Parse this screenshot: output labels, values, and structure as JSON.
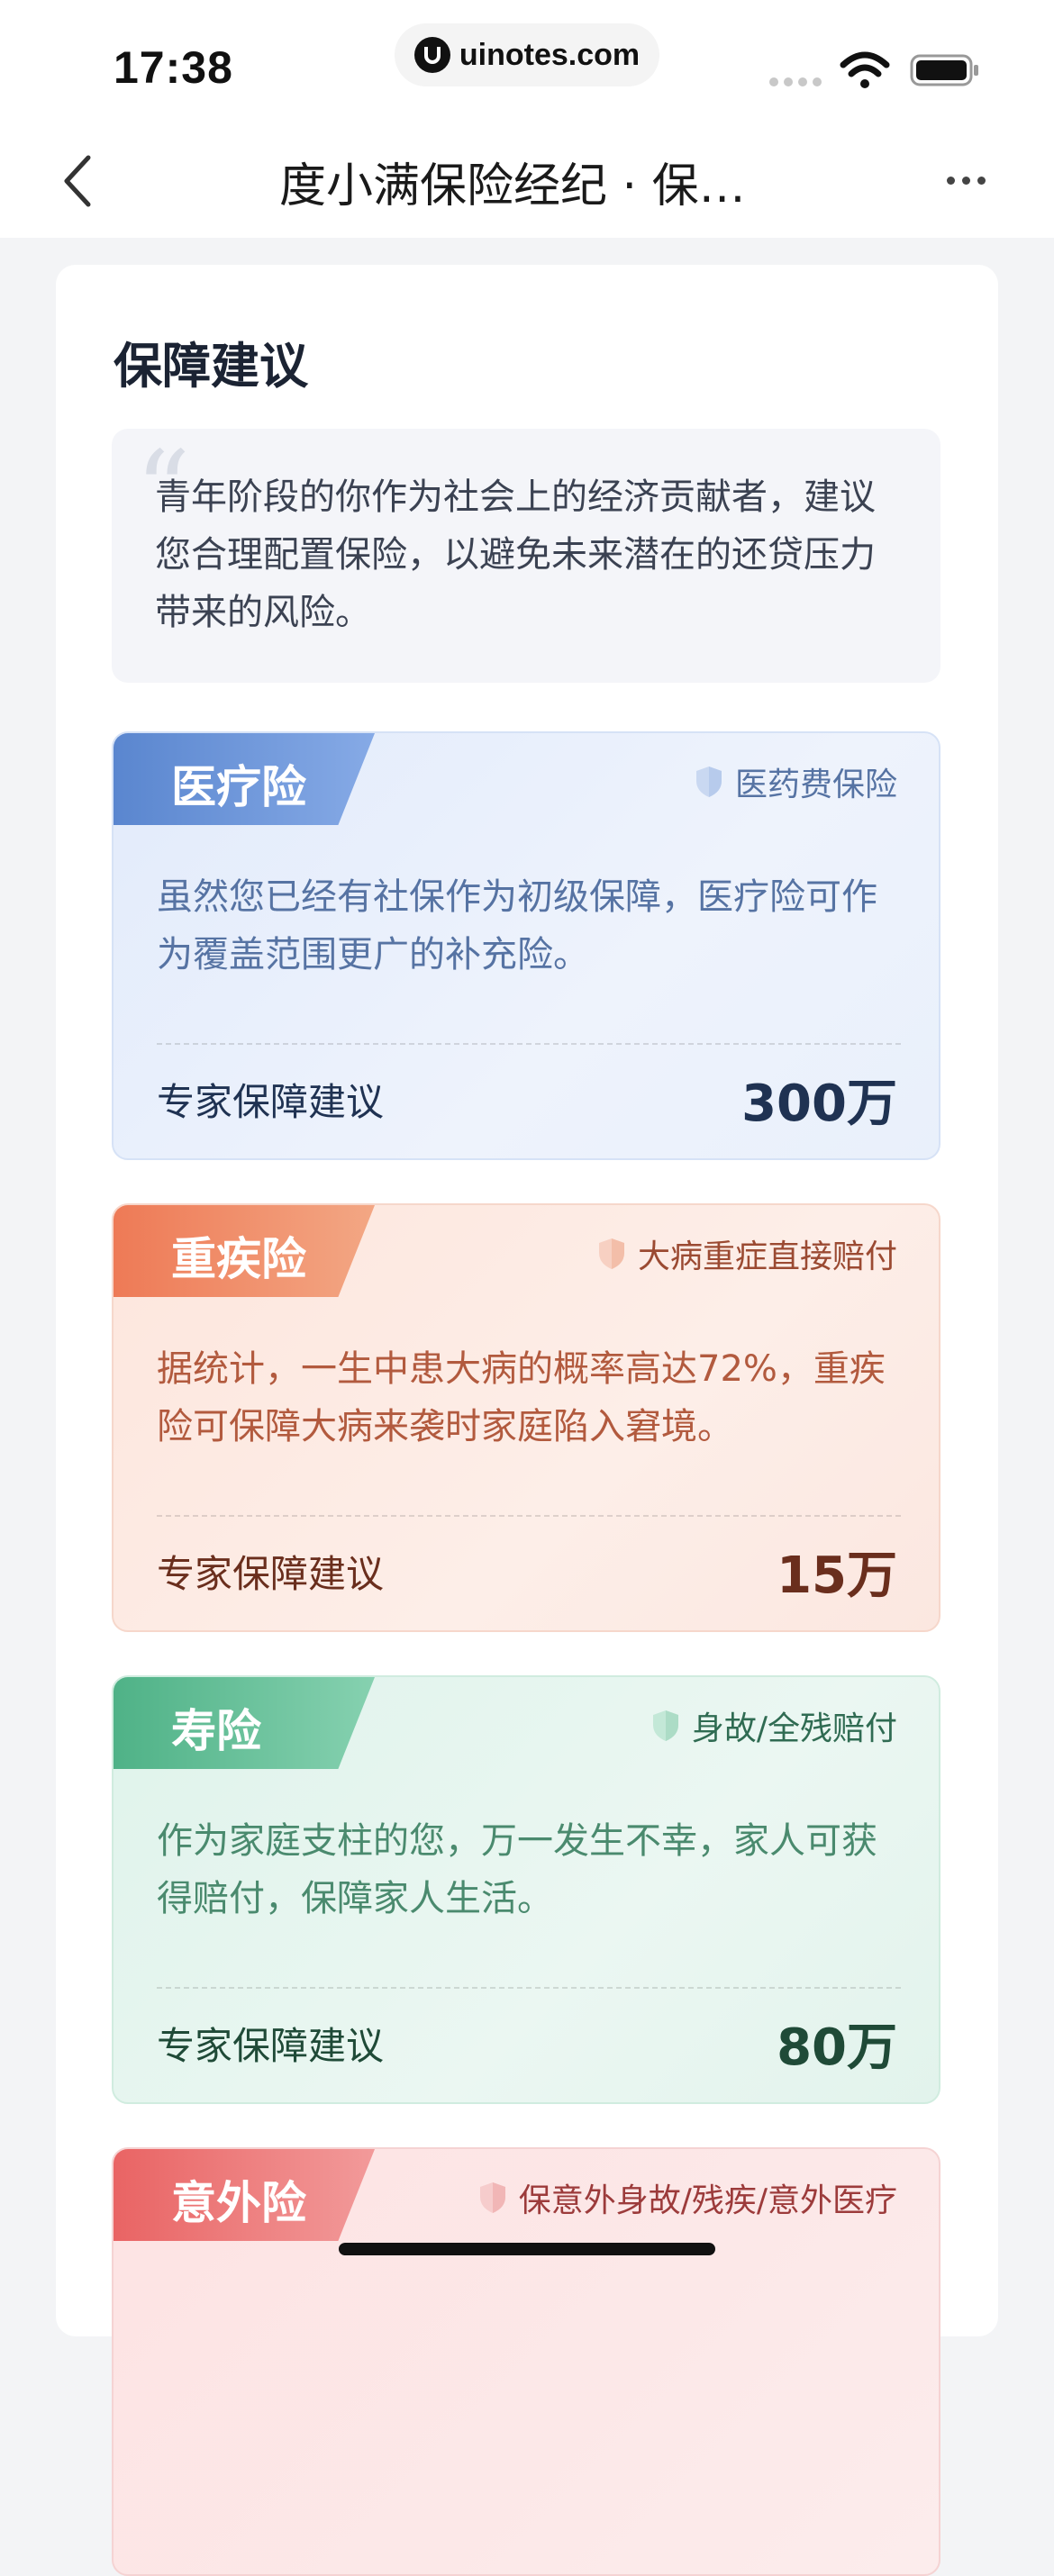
{
  "status_bar": {
    "time": "17:38",
    "url": "uinotes.com"
  },
  "nav": {
    "title": "度小满保险经纪 · 保…"
  },
  "main": {
    "section_title": "保障建议",
    "quote_mark": "“",
    "intro": "青年阶段的你作为社会上的经济贡献者，建议您合理配置保险，以避免未来潜在的还贷压力带来的风险。"
  },
  "cards": {
    "medical": {
      "name": "医疗险",
      "tag": "医药费保险",
      "desc": "虽然您已经有社保作为初级保障，医疗险可作为覆盖范围更广的补充险。",
      "advice_label": "专家保障建议",
      "amount": "300万"
    },
    "critical": {
      "name": "重疾险",
      "tag": "大病重症直接赔付",
      "desc": "据统计，一生中患大病的概率高达72%，重疾险可保障大病来袭时家庭陷入窘境。",
      "advice_label": "专家保障建议",
      "amount": "15万"
    },
    "life": {
      "name": "寿险",
      "tag": "身故/全残赔付",
      "desc": "作为家庭支柱的您，万一发生不幸，家人可获得赔付，保障家人生活。",
      "advice_label": "专家保障建议",
      "amount": "80万"
    },
    "accident": {
      "name": "意外险",
      "tag": "保意外身故/残疾/意外医疗"
    }
  },
  "colors": {
    "medical": "#5a86cf",
    "critical": "#ee7a56",
    "life": "#4fb287",
    "accident": "#e96464"
  },
  "icons": {
    "back": "chevron-left-icon",
    "more": "more-dots-icon",
    "tag": "shield-icon"
  }
}
